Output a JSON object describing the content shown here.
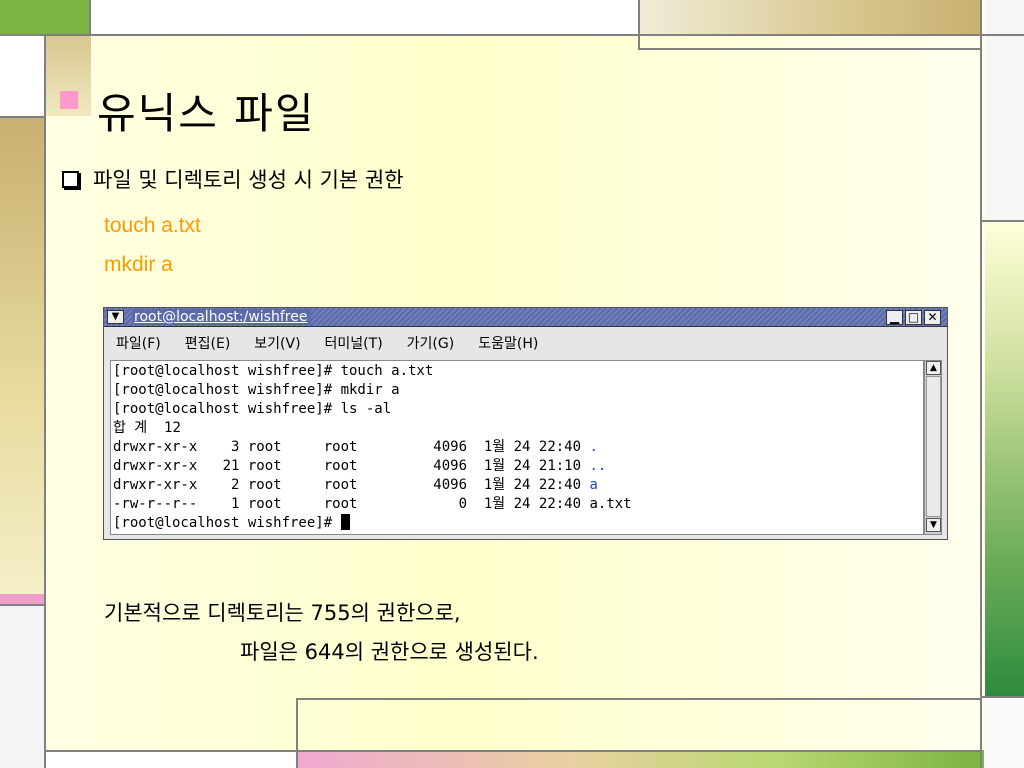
{
  "slide": {
    "title": "유닉스 파일",
    "subtitle": "파일 및 디렉토리 생성 시 기본 권한",
    "commands": [
      "touch a.txt",
      "mkdir a"
    ],
    "footer": [
      "기본적으로 디렉토리는 755의 권한으로,",
      "파일은 644의 권한으로 생성된다."
    ]
  },
  "terminal": {
    "title": "root@localhost:/wishfree",
    "menu": [
      "파일(F)",
      "편집(E)",
      "보기(V)",
      "터미널(T)",
      "가기(G)",
      "도움말(H)"
    ],
    "lines": [
      "[root@localhost wishfree]# touch a.txt",
      "[root@localhost wishfree]# mkdir a",
      "[root@localhost wishfree]# ls -al",
      "합 계  12",
      "drwxr-xr-x    3 root     root         4096  1월 24 22:40 ",
      "drwxr-xr-x   21 root     root         4096  1월 24 21:10 ",
      "drwxr-xr-x    2 root     root         4096  1월 24 22:40 ",
      "-rw-r--r--    1 root     root            0  1월 24 22:40 a.txt",
      "[root@localhost wishfree]# "
    ],
    "blue_names": [
      ".",
      "..",
      "a"
    ]
  },
  "icons": {
    "window_menu": "chevron-down-icon",
    "minimize": "minimize-icon",
    "maximize": "maximize-icon",
    "close": "close-icon",
    "scroll_up": "arrow-up-icon",
    "scroll_down": "arrow-down-icon"
  },
  "colors": {
    "accent_pink": "#ff99cc",
    "command_orange": "#ff9900",
    "gold": "#c8b070",
    "green": "#2e8b3e"
  }
}
